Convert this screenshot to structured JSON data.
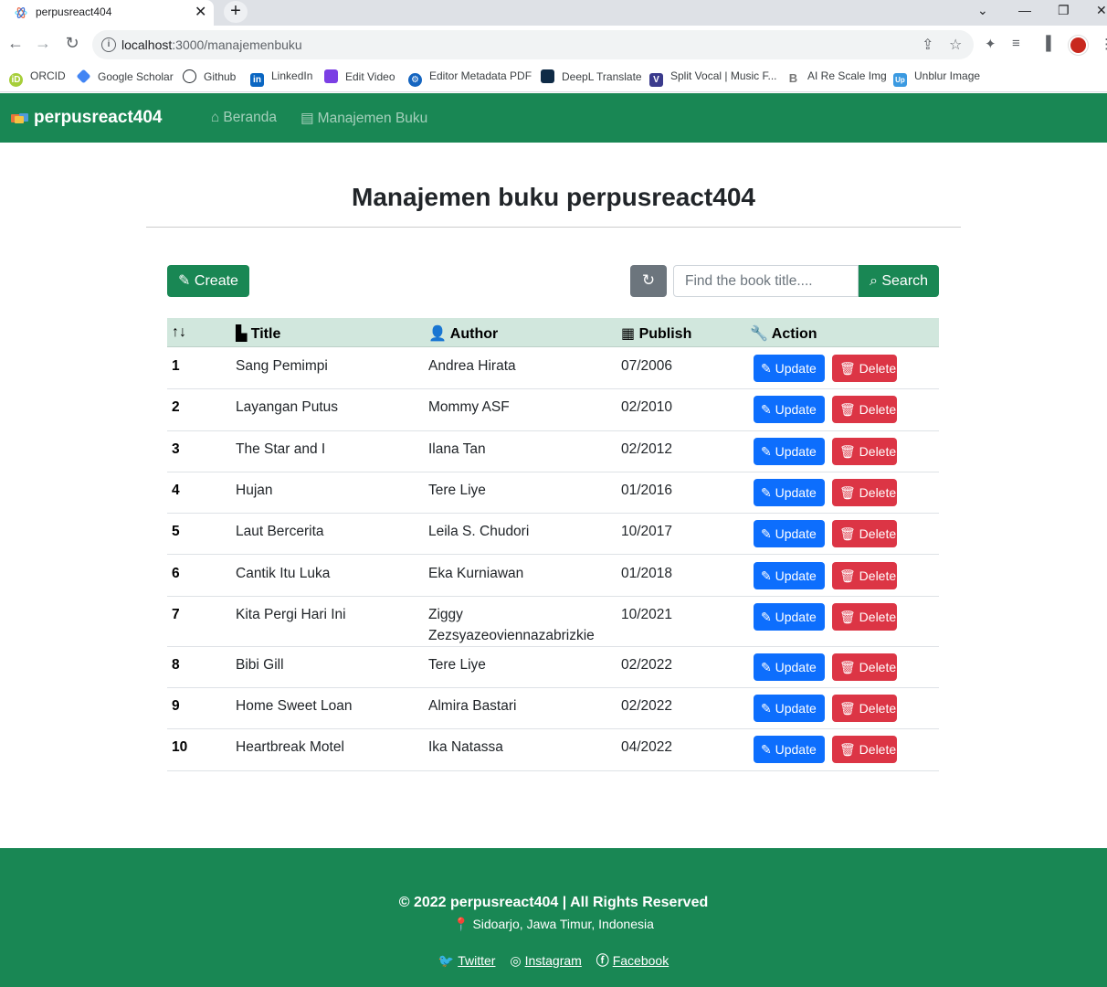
{
  "browser": {
    "tab_title": "perpusreact404",
    "url_host": "localhost",
    "url_path": ":3000/manajemenbuku",
    "bookmarks": [
      {
        "label": "ORCID",
        "icon": "orcid-icon",
        "color": "#a6ce39"
      },
      {
        "label": "Google Scholar",
        "icon": "google-scholar-icon",
        "color": "#4285f4"
      },
      {
        "label": "Github",
        "icon": "github-icon",
        "color": "#24292e"
      },
      {
        "label": "LinkedIn",
        "icon": "linkedin-icon",
        "color": "#0a66c2"
      },
      {
        "label": "Edit Video",
        "icon": "edit-video-icon",
        "color": "#7b3fe4"
      },
      {
        "label": "Editor Metadata PDF",
        "icon": "gear-icon",
        "color": "#1565c0"
      },
      {
        "label": "DeepL Translate",
        "icon": "deepl-icon",
        "color": "#0f2b46"
      },
      {
        "label": "Split Vocal | Music F...",
        "icon": "vocal-icon",
        "color": "#3a3a8c"
      },
      {
        "label": "AI Re Scale Img",
        "icon": "rescale-icon",
        "color": "#777777"
      },
      {
        "label": "Unblur Image",
        "icon": "unblur-icon",
        "color": "#3b9ae1"
      }
    ]
  },
  "navbar": {
    "brand": "perpusreact404",
    "links": [
      {
        "label": "Beranda",
        "icon": "home-icon"
      },
      {
        "label": "Manajemen Buku",
        "icon": "book-icon"
      }
    ],
    "color": "#198754"
  },
  "page": {
    "title": "Manajemen buku perpusreact404",
    "create_label": "Create",
    "search_placeholder": "Find the book title....",
    "search_label": "Search"
  },
  "table": {
    "headers": {
      "no": "",
      "title": "Title",
      "author": "Author",
      "publish": "Publish",
      "action": "Action"
    },
    "update_label": "Update",
    "delete_label": "Delete",
    "rows": [
      {
        "no": "1",
        "title": "Sang Pemimpi",
        "author": "Andrea Hirata",
        "publish": "07/2006"
      },
      {
        "no": "2",
        "title": "Layangan Putus",
        "author": "Mommy ASF",
        "publish": "02/2010"
      },
      {
        "no": "3",
        "title": "The Star and I",
        "author": "Ilana Tan",
        "publish": "02/2012"
      },
      {
        "no": "4",
        "title": "Hujan",
        "author": "Tere Liye",
        "publish": "01/2016"
      },
      {
        "no": "5",
        "title": "Laut Bercerita",
        "author": "Leila S. Chudori",
        "publish": "10/2017"
      },
      {
        "no": "6",
        "title": "Cantik Itu Luka",
        "author": "Eka Kurniawan",
        "publish": "01/2018"
      },
      {
        "no": "7",
        "title": "Kita Pergi Hari Ini",
        "author": "Ziggy Zezsyazeoviennazabrizkie",
        "publish": "10/2021"
      },
      {
        "no": "8",
        "title": "Bibi Gill",
        "author": "Tere Liye",
        "publish": "02/2022"
      },
      {
        "no": "9",
        "title": "Home Sweet Loan",
        "author": "Almira Bastari",
        "publish": "02/2022"
      },
      {
        "no": "10",
        "title": "Heartbreak Motel",
        "author": "Ika Natassa",
        "publish": "04/2022"
      }
    ]
  },
  "footer": {
    "copyright": "© 2022 perpusreact404 | All Rights Reserved",
    "location": "Sidoarjo, Jawa Timur, Indonesia",
    "links": [
      {
        "label": "Twitter",
        "icon": "twitter-icon"
      },
      {
        "label": "Instagram",
        "icon": "instagram-icon"
      },
      {
        "label": "Facebook",
        "icon": "facebook-icon"
      }
    ]
  }
}
